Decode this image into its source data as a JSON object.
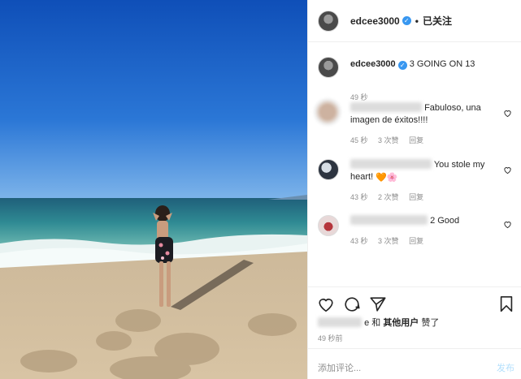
{
  "header": {
    "username": "edcee3000",
    "verified_badge": "verified-icon",
    "separator": "•",
    "follow_status": "已关注"
  },
  "caption": {
    "username": "edcee3000",
    "text": "3 GOING ON 13",
    "time": "49 秒"
  },
  "comments": [
    {
      "text": "Fabuloso, una imagen de éxitos!!!!",
      "time": "45 秒",
      "likes": "3 次赞",
      "reply": "回复"
    },
    {
      "text_before": "You stole my heart!",
      "emojis": [
        "🧡",
        "🌸"
      ],
      "time": "43 秒",
      "likes": "2 次赞",
      "reply": "回复"
    },
    {
      "text": "2 Good",
      "time": "43 秒",
      "likes": "3 次赞",
      "reply": "回复"
    }
  ],
  "actions": {
    "liked_prefix": "e 和",
    "liked_by": "其他用户",
    "liked_suffix": "赞了",
    "time_ago": "49 秒前"
  },
  "add_comment": {
    "placeholder": "添加评论...",
    "post_label": "发布"
  },
  "colors": {
    "accent": "#3897f0",
    "post_disabled": "#b2dffc",
    "meta_gray": "#8e8e8e"
  }
}
